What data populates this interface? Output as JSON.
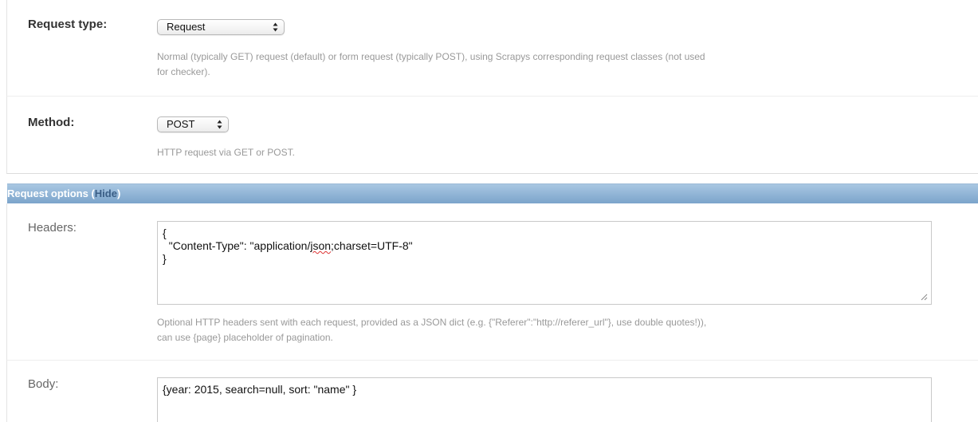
{
  "request_type": {
    "label": "Request type:",
    "selected": "Request",
    "help": "Normal (typically GET) request (default) or form request (typically POST), using Scrapys corresponding request classes (not used",
    "help_line2": "for checker)."
  },
  "method": {
    "label": "Method:",
    "selected": "POST",
    "help": "HTTP request via GET or POST."
  },
  "request_options": {
    "title": "Request options (",
    "hide_label": "Hide",
    "title_close": ")"
  },
  "headers": {
    "label": "Headers:",
    "line1": "{",
    "line2_prefix": "  \"Content-Type\": \"application/",
    "line2_misspelled": "json",
    "line2_suffix": ";charset=UTF-8\"",
    "line3": "}",
    "help": "Optional HTTP headers sent with each request, provided as a JSON dict (e.g. {\"Referer\":\"http://referer_url\"}, use double quotes!)),",
    "help_line2": "can use {page} placeholder of pagination."
  },
  "body": {
    "label": "Body:",
    "value": "{year: 2015, search=null, sort: \"name\" }"
  },
  "icons": {
    "select_arrows": "updown-arrows-icon",
    "resize": "resize-grip-icon"
  },
  "colors": {
    "section_bar": "#7ba4cb",
    "hide_link": "#3a5e86"
  }
}
